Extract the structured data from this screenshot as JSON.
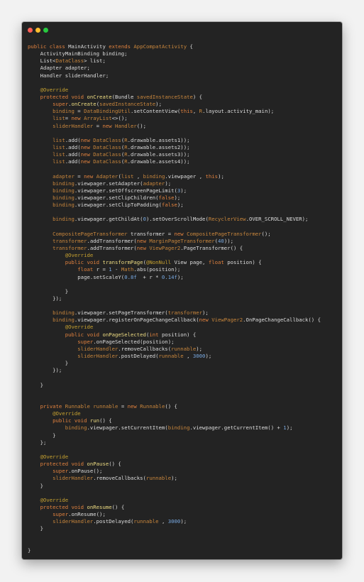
{
  "window": {
    "controls": [
      "close",
      "minimize",
      "maximize"
    ],
    "colors": {
      "close": "#ff5f56",
      "minimize": "#ffbd2e",
      "maximize": "#27c93f",
      "background": "#232323"
    }
  },
  "code_lines": [
    [
      [
        "kw",
        "public class "
      ],
      [
        "pl",
        "MainActivity "
      ],
      [
        "kw",
        "extends "
      ],
      [
        "ty",
        "AppCompatActivity"
      ],
      [
        "pl",
        " {"
      ]
    ],
    [
      [
        "pl",
        "    ActivityMainBinding binding;"
      ]
    ],
    [
      [
        "pl",
        "    List<"
      ],
      [
        "ty",
        "DataClass"
      ],
      [
        "pl",
        "> list;"
      ]
    ],
    [
      [
        "pl",
        "    Adapter adapter;"
      ]
    ],
    [
      [
        "pl",
        "    Handler sliderHandler;"
      ]
    ],
    [],
    [
      [
        "ann",
        "    @Override"
      ]
    ],
    [
      [
        "kw",
        "    protected void "
      ],
      [
        "fn",
        "onCreate"
      ],
      [
        "pl",
        "(Bundle "
      ],
      [
        "ty",
        "savedInstanceState"
      ],
      [
        "pl",
        ") {"
      ]
    ],
    [
      [
        "kw",
        "        super"
      ],
      [
        "pl",
        "."
      ],
      [
        "fn",
        "onCreate"
      ],
      [
        "pl",
        "("
      ],
      [
        "ty",
        "savedInstanceState"
      ],
      [
        "pl",
        ");"
      ]
    ],
    [
      [
        "ty",
        "        binding"
      ],
      [
        "pl",
        " = "
      ],
      [
        "ty",
        "DataBindingUtil"
      ],
      [
        "pl",
        ".setContentView("
      ],
      [
        "kw",
        "this"
      ],
      [
        "pl",
        ", "
      ],
      [
        "ty",
        "R"
      ],
      [
        "pl",
        ".layout.activity_main);"
      ]
    ],
    [
      [
        "ty",
        "        list"
      ],
      [
        "pl",
        "= "
      ],
      [
        "kw",
        "new "
      ],
      [
        "ty",
        "ArrayList"
      ],
      [
        "pl",
        "<>();"
      ]
    ],
    [
      [
        "ty",
        "        sliderHandler"
      ],
      [
        "pl",
        " = "
      ],
      [
        "kw",
        "new "
      ],
      [
        "ty",
        "Handler"
      ],
      [
        "pl",
        "();"
      ]
    ],
    [],
    [
      [
        "ty",
        "        list"
      ],
      [
        "pl",
        ".add("
      ],
      [
        "kw",
        "new "
      ],
      [
        "ty",
        "DataClass"
      ],
      [
        "pl",
        "("
      ],
      [
        "ty",
        "R"
      ],
      [
        "pl",
        ".drawable.assets1));"
      ]
    ],
    [
      [
        "ty",
        "        list"
      ],
      [
        "pl",
        ".add("
      ],
      [
        "kw",
        "new "
      ],
      [
        "ty",
        "DataClass"
      ],
      [
        "pl",
        "("
      ],
      [
        "ty",
        "R"
      ],
      [
        "pl",
        ".drawable.assets2));"
      ]
    ],
    [
      [
        "ty",
        "        list"
      ],
      [
        "pl",
        ".add("
      ],
      [
        "kw",
        "new "
      ],
      [
        "ty",
        "DataClass"
      ],
      [
        "pl",
        "("
      ],
      [
        "ty",
        "R"
      ],
      [
        "pl",
        ".drawable.assets3));"
      ]
    ],
    [
      [
        "ty",
        "        list"
      ],
      [
        "pl",
        ".add("
      ],
      [
        "kw",
        "new "
      ],
      [
        "ty",
        "DataClass"
      ],
      [
        "pl",
        "("
      ],
      [
        "ty",
        "R"
      ],
      [
        "pl",
        ".drawable.assets4));"
      ]
    ],
    [],
    [
      [
        "ty",
        "        adapter"
      ],
      [
        "pl",
        " = "
      ],
      [
        "kw",
        "new "
      ],
      [
        "ty",
        "Adapter"
      ],
      [
        "pl",
        "("
      ],
      [
        "ty",
        "list"
      ],
      [
        "pl",
        " , "
      ],
      [
        "ty",
        "binding"
      ],
      [
        "pl",
        ".viewpager , "
      ],
      [
        "kw",
        "this"
      ],
      [
        "pl",
        ");"
      ]
    ],
    [
      [
        "ty",
        "        binding"
      ],
      [
        "pl",
        ".viewpager.setAdapter("
      ],
      [
        "ty",
        "adapter"
      ],
      [
        "pl",
        ");"
      ]
    ],
    [
      [
        "ty",
        "        binding"
      ],
      [
        "pl",
        ".viewpager.setOffscreenPageLimit("
      ],
      [
        "num",
        "3"
      ],
      [
        "pl",
        ");"
      ]
    ],
    [
      [
        "ty",
        "        binding"
      ],
      [
        "pl",
        ".viewpager.setClipChildren("
      ],
      [
        "kw",
        "false"
      ],
      [
        "pl",
        ");"
      ]
    ],
    [
      [
        "ty",
        "        binding"
      ],
      [
        "pl",
        ".viewpager.setClipToPadding("
      ],
      [
        "kw",
        "false"
      ],
      [
        "pl",
        ");"
      ]
    ],
    [],
    [
      [
        "ty",
        "        binding"
      ],
      [
        "pl",
        ".viewpager.getChildAt("
      ],
      [
        "num",
        "0"
      ],
      [
        "pl",
        ").setOverScrollMode("
      ],
      [
        "ty",
        "RecyclerView"
      ],
      [
        "pl",
        ".OVER_SCROLL_NEVER);"
      ]
    ],
    [],
    [
      [
        "ty",
        "        CompositePageTransformer"
      ],
      [
        "pl",
        " transformer = "
      ],
      [
        "kw",
        "new "
      ],
      [
        "ty",
        "CompositePageTransformer"
      ],
      [
        "pl",
        "();"
      ]
    ],
    [
      [
        "ty",
        "        transformer"
      ],
      [
        "pl",
        ".addTransformer("
      ],
      [
        "kw",
        "new "
      ],
      [
        "ty",
        "MarginPageTransformer"
      ],
      [
        "pl",
        "("
      ],
      [
        "num",
        "40"
      ],
      [
        "pl",
        "));"
      ]
    ],
    [
      [
        "ty",
        "        transformer"
      ],
      [
        "pl",
        ".addTransformer("
      ],
      [
        "kw",
        "new "
      ],
      [
        "ty",
        "ViewPager2"
      ],
      [
        "pl",
        ".PageTransformer() {"
      ]
    ],
    [
      [
        "ann",
        "            @Override"
      ]
    ],
    [
      [
        "kw",
        "            public void "
      ],
      [
        "fn",
        "transformPage"
      ],
      [
        "pl",
        "("
      ],
      [
        "ann",
        "@NonNull"
      ],
      [
        "pl",
        " View page, "
      ],
      [
        "kw",
        "float "
      ],
      [
        "pl",
        "position) {"
      ]
    ],
    [
      [
        "kw",
        "                float "
      ],
      [
        "pl",
        "r = "
      ],
      [
        "num",
        "1"
      ],
      [
        "pl",
        " - "
      ],
      [
        "ty",
        "Math"
      ],
      [
        "pl",
        ".abs(position);"
      ]
    ],
    [
      [
        "pl",
        "                page.setScaleY("
      ],
      [
        "num",
        "0.8f"
      ],
      [
        "pl",
        "  + r * "
      ],
      [
        "num",
        "0.14f"
      ],
      [
        "pl",
        ");"
      ]
    ],
    [],
    [
      [
        "pl",
        "            }"
      ]
    ],
    [
      [
        "pl",
        "        });"
      ]
    ],
    [],
    [
      [
        "ty",
        "        binding"
      ],
      [
        "pl",
        ".viewpager.setPageTransformer("
      ],
      [
        "ty",
        "transformer"
      ],
      [
        "pl",
        ");"
      ]
    ],
    [
      [
        "ty",
        "        binding"
      ],
      [
        "pl",
        ".viewpager.registerOnPageChangeCallback("
      ],
      [
        "kw",
        "new "
      ],
      [
        "ty",
        "ViewPager2"
      ],
      [
        "pl",
        ".OnPageChangeCallback() {"
      ]
    ],
    [
      [
        "ann",
        "            @Override"
      ]
    ],
    [
      [
        "kw",
        "            public void "
      ],
      [
        "fn",
        "onPageSelected"
      ],
      [
        "pl",
        "("
      ],
      [
        "kw",
        "int "
      ],
      [
        "pl",
        "position) {"
      ]
    ],
    [
      [
        "kw",
        "                super"
      ],
      [
        "pl",
        ".onPageSelected(position);"
      ]
    ],
    [
      [
        "ty",
        "                sliderHandler"
      ],
      [
        "pl",
        ".removeCallbacks("
      ],
      [
        "ty",
        "runnable"
      ],
      [
        "pl",
        ");"
      ]
    ],
    [
      [
        "ty",
        "                sliderHandler"
      ],
      [
        "pl",
        ".postDelayed("
      ],
      [
        "ty",
        "runnable"
      ],
      [
        "pl",
        " , "
      ],
      [
        "num",
        "3000"
      ],
      [
        "pl",
        ");"
      ]
    ],
    [
      [
        "pl",
        "            }"
      ]
    ],
    [
      [
        "pl",
        "        });"
      ]
    ],
    [],
    [
      [
        "pl",
        "    }"
      ]
    ],
    [],
    [],
    [
      [
        "kw",
        "    private "
      ],
      [
        "ty",
        "Runnable"
      ],
      [
        "pl",
        " "
      ],
      [
        "ty",
        "runnable"
      ],
      [
        "pl",
        " = "
      ],
      [
        "kw",
        "new "
      ],
      [
        "ty",
        "Runnable"
      ],
      [
        "pl",
        "() {"
      ]
    ],
    [
      [
        "ann",
        "        @Override"
      ]
    ],
    [
      [
        "kw",
        "        public void "
      ],
      [
        "fn",
        "run"
      ],
      [
        "pl",
        "() {"
      ]
    ],
    [
      [
        "ty",
        "            binding"
      ],
      [
        "pl",
        ".viewpager.setCurrentItem("
      ],
      [
        "ty",
        "binding"
      ],
      [
        "pl",
        ".viewpager.getCurrentItem() + "
      ],
      [
        "num",
        "1"
      ],
      [
        "pl",
        ");"
      ]
    ],
    [
      [
        "pl",
        "        }"
      ]
    ],
    [
      [
        "pl",
        "    };"
      ]
    ],
    [],
    [
      [
        "ann",
        "    @Override"
      ]
    ],
    [
      [
        "kw",
        "    protected void "
      ],
      [
        "fn",
        "onPause"
      ],
      [
        "pl",
        "() {"
      ]
    ],
    [
      [
        "kw",
        "        super"
      ],
      [
        "pl",
        ".onPause();"
      ]
    ],
    [
      [
        "ty",
        "        sliderHandler"
      ],
      [
        "pl",
        ".removeCallbacks("
      ],
      [
        "ty",
        "runnable"
      ],
      [
        "pl",
        ");"
      ]
    ],
    [
      [
        "pl",
        "    }"
      ]
    ],
    [],
    [
      [
        "ann",
        "    @Override"
      ]
    ],
    [
      [
        "kw",
        "    protected void "
      ],
      [
        "fn",
        "onResume"
      ],
      [
        "pl",
        "() {"
      ]
    ],
    [
      [
        "kw",
        "        super"
      ],
      [
        "pl",
        ".onResume();"
      ]
    ],
    [
      [
        "ty",
        "        sliderHandler"
      ],
      [
        "pl",
        ".postDelayed("
      ],
      [
        "ty",
        "runnable"
      ],
      [
        "pl",
        " , "
      ],
      [
        "num",
        "3000"
      ],
      [
        "pl",
        ");"
      ]
    ],
    [
      [
        "pl",
        "    }"
      ]
    ],
    [],
    [],
    [
      [
        "pl",
        "}"
      ]
    ]
  ]
}
